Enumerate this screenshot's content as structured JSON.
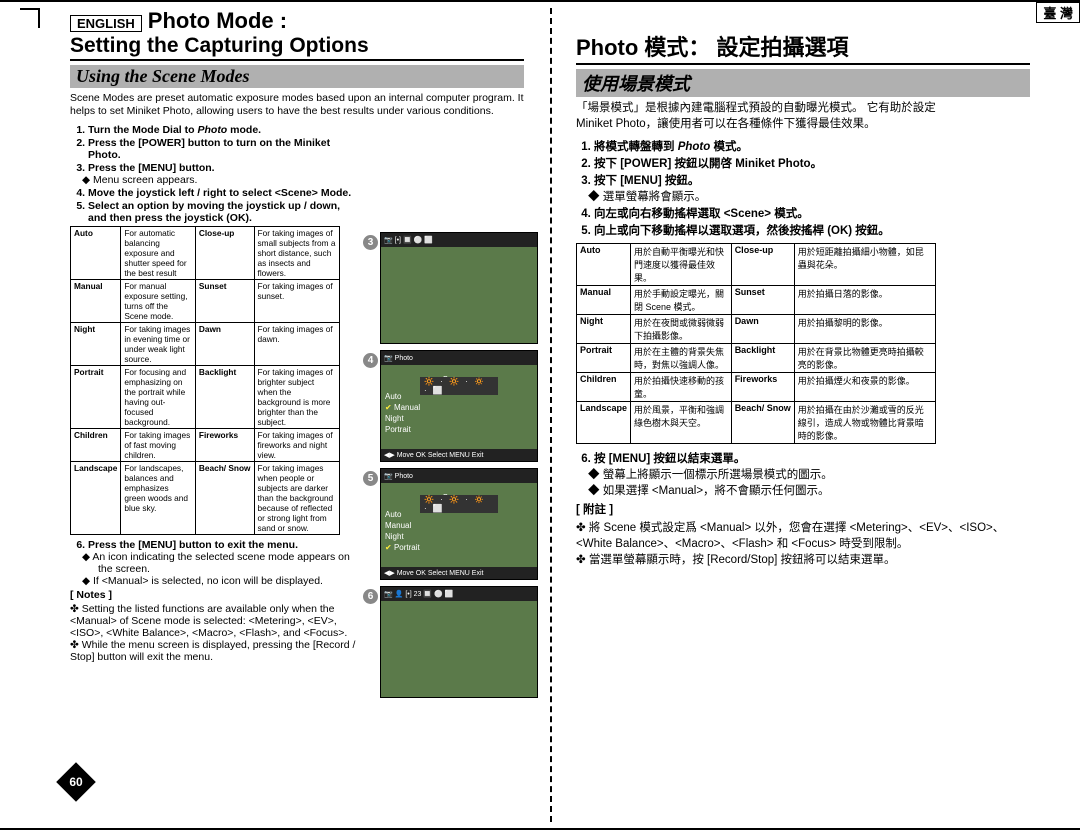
{
  "page_number": "60",
  "left": {
    "lang_box": "ENGLISH",
    "title1": "Photo Mode :",
    "title2": "Setting the Capturing Options",
    "section": "Using the Scene Modes",
    "intro": "Scene Modes are preset automatic exposure modes based upon an internal computer program. It helps to set Miniket Photo, allowing users to have the best results under various conditions.",
    "steps": [
      {
        "text": "Turn the Mode Dial to",
        "em": "Photo",
        "tail": "mode."
      },
      {
        "text": "Press the [POWER] button to turn on the Miniket Photo."
      },
      {
        "text": "Press the [MENU] button.",
        "sub": "Menu screen appears."
      },
      {
        "text": "Move the joystick left / right to select <Scene> Mode."
      },
      {
        "text": "Select an option by moving the joystick up / down, and then press the joystick (OK)."
      }
    ],
    "modes": [
      [
        "Auto",
        "For automatic balancing exposure and shutter speed for the best result",
        "Close-up",
        "For taking images of small subjects from a short distance, such as insects and flowers."
      ],
      [
        "Manual",
        "For manual exposure setting, turns off the Scene mode.",
        "Sunset",
        "For taking images of sunset."
      ],
      [
        "Night",
        "For taking images in evening time or under weak light source.",
        "Dawn",
        "For taking images of dawn."
      ],
      [
        "Portrait",
        "For focusing and emphasizing on the portrait while having out-focused background.",
        "Backlight",
        "For taking images of brighter subject when the background is more brighter than the subject."
      ],
      [
        "Children",
        "For taking images of fast moving children.",
        "Fireworks",
        "For taking images of fireworks and night view."
      ],
      [
        "Landscape",
        "For landscapes, balances and emphasizes green woods and blue sky.",
        "Beach/\nSnow",
        "For taking images when people or subjects are darker than the background because of reflected or strong light from sand or snow."
      ]
    ],
    "step6": "Press the [MENU] button to exit the menu.",
    "step6_bullets": [
      "An icon indicating the selected scene mode appears on the screen.",
      "If <Manual> is selected, no icon will be displayed."
    ],
    "notes_label": "[ Notes ]",
    "notes": [
      "Setting the listed functions are available only when the <Manual> of Scene mode is selected: <Metering>, <EV>, <ISO>, <White Balance>, <Macro>, <Flash>, and <Focus>.",
      "While the menu screen is displayed, pressing the [Record / Stop] button will exit the menu."
    ]
  },
  "right": {
    "lang_box": "臺 灣",
    "title": "Photo 模式： 設定拍攝選項",
    "section": "使用場景模式",
    "intro1": "「場景模式」是根據內建電腦程式預設的自動曝光模式。 它有助於設定",
    "intro2": "Miniket Photo，讓使用者可以在各種條件下獲得最佳效果。",
    "steps": [
      {
        "pre": "將模式轉盤轉到",
        "em": "Photo",
        "tail": "模式。"
      },
      {
        "text": "按下 [POWER] 按鈕以開啓 Miniket Photo。"
      },
      {
        "text": "按下 [MENU] 按鈕。",
        "sub": "選單螢幕將會顯示。"
      },
      {
        "text": "向左或向右移動搖桿選取 <Scene> 模式。"
      },
      {
        "text": "向上或向下移動搖桿以選取選項，然後按搖桿 (OK) 按鈕。"
      }
    ],
    "modes": [
      [
        "Auto",
        "用於自動平衡曝光和快門速度以獲得最佳效果。",
        "Close-up",
        "用於短距離拍攝細小物體，如昆蟲與花朵。"
      ],
      [
        "Manual",
        "用於手動設定曝光，關閉 Scene 模式。",
        "Sunset",
        "用於拍攝日落的影像。"
      ],
      [
        "Night",
        "用於在夜間或微弱微弱下拍攝影像。",
        "Dawn",
        "用於拍攝黎明的影像。"
      ],
      [
        "Portrait",
        "用於在主體的背景失焦時，對焦以強調人像。",
        "Backlight",
        "用於在背景比物體更亮時拍攝較亮的影像。"
      ],
      [
        "Children",
        "用於拍攝快速移動的孩童。",
        "Fireworks",
        "用於拍攝煙火和夜景的影像。"
      ],
      [
        "Landscape",
        "用於風景，平衡和強調綠色樹木與天空。",
        "Beach/\nSnow",
        "用於拍攝在由於沙灘或雪的反光線引，造成人物或物體比背景暗時的影像。"
      ]
    ],
    "step6": "按 [MENU] 按鈕以結束選單。",
    "step6_bullets": [
      "螢幕上將顯示一個標示所選場景模式的圖示。",
      "如果選擇 <Manual>，將不會顯示任何圖示。"
    ],
    "notes_label": "[ 附註 ]",
    "notes": [
      "將 Scene 模式設定爲 <Manual> 以外，您會在選擇 <Metering>、<EV>、<ISO>、<White Balance>、<Macro>、<Flash> 和 <Focus> 時受到限制。",
      "當選單螢幕顯示時，按 [Record/Stop] 按鈕將可以結束選單。"
    ]
  },
  "strip": {
    "shots": [
      {
        "num": "3",
        "top": "📷  [•]  🔲  ⚪  ⬜",
        "bot": ""
      },
      {
        "num": "4",
        "top": "📷 Photo",
        "scene": "Scene",
        "icobar": "🔆 · 🔆 · 🔅 · ⬜",
        "menu": [
          "Auto",
          "Manual",
          "Night",
          "Portrait"
        ],
        "sel": 1,
        "bot": "◀▶ Move   OK Select   MENU Exit"
      },
      {
        "num": "5",
        "top": "📷 Photo",
        "scene": "Scene",
        "icobar": "🔆 · 🔆 · 🔅 · ⬜",
        "menu": [
          "Auto",
          "Manual",
          "Night",
          "Portrait"
        ],
        "sel": 3,
        "bot": "◀▶ Move   OK Select   MENU Exit"
      },
      {
        "num": "6",
        "top": "📷 👤 [•]   23  🔲 ⚪ ⬜",
        "bot": ""
      }
    ]
  }
}
